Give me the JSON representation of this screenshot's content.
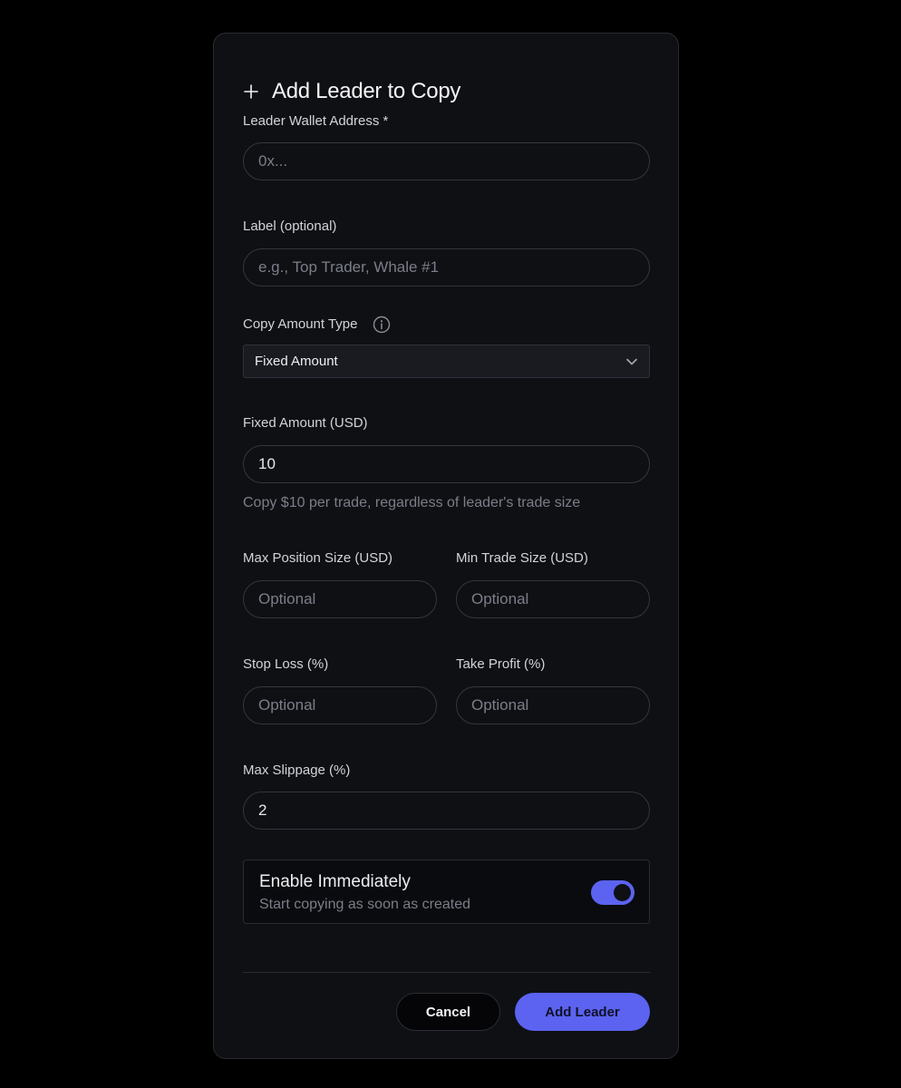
{
  "modal": {
    "title": "Add Leader to Copy"
  },
  "form": {
    "leader_wallet": {
      "label": "Leader Wallet Address *",
      "placeholder": "0x...",
      "value": ""
    },
    "label_field": {
      "label": "Label (optional)",
      "placeholder": "e.g., Top Trader, Whale #1",
      "value": ""
    },
    "copy_amount_type": {
      "label": "Copy Amount Type",
      "selected": "Fixed Amount"
    },
    "fixed_amount": {
      "label": "Fixed Amount (USD)",
      "value": "10",
      "helper": "Copy $10 per trade, regardless of leader's trade size"
    },
    "max_position": {
      "label": "Max Position Size (USD)",
      "placeholder": "Optional",
      "value": ""
    },
    "min_trade": {
      "label": "Min Trade Size (USD)",
      "placeholder": "Optional",
      "value": ""
    },
    "stop_loss": {
      "label": "Stop Loss (%)",
      "placeholder": "Optional",
      "value": ""
    },
    "take_profit": {
      "label": "Take Profit (%)",
      "placeholder": "Optional",
      "value": ""
    },
    "max_slippage": {
      "label": "Max Slippage (%)",
      "value": "2"
    }
  },
  "enable": {
    "title": "Enable Immediately",
    "subtitle": "Start copying as soon as created",
    "on": true
  },
  "actions": {
    "cancel_label": "Cancel",
    "submit_label": "Add Leader"
  },
  "colors": {
    "accent": "#5b63f0",
    "modal_bg": "#0f1014",
    "page_bg": "#000000"
  },
  "icons": {
    "header": "plus-icon",
    "copy_amount_type": "info-icon",
    "select": "chevron-down-icon"
  }
}
